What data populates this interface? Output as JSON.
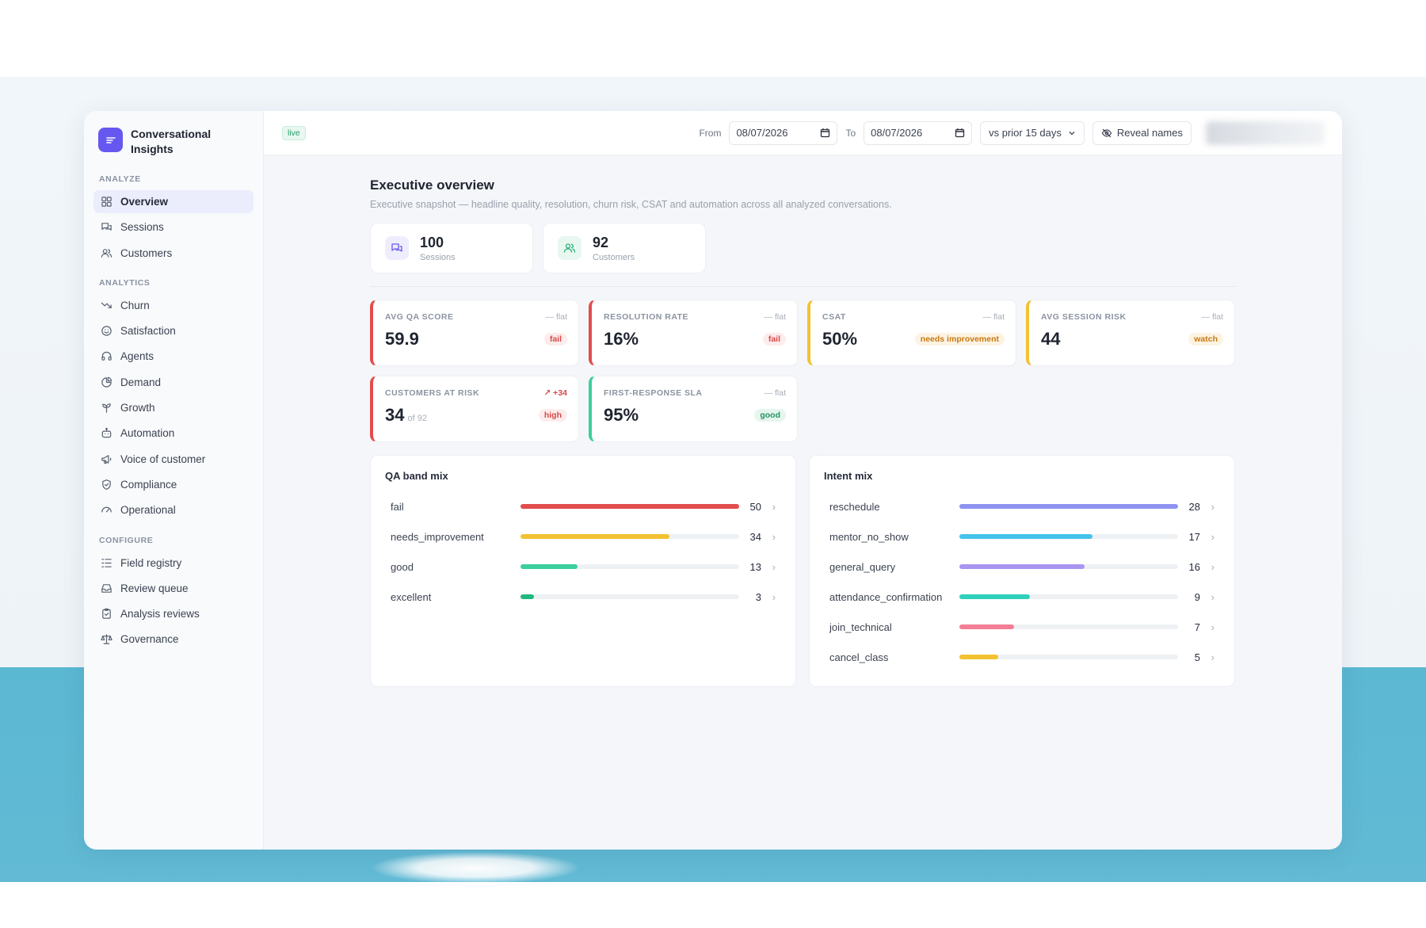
{
  "app": {
    "name": "Conversational Insights"
  },
  "sidebar": {
    "sections": [
      {
        "title": "ANALYZE",
        "items": [
          {
            "label": "Overview",
            "icon": "grid-icon",
            "active": true
          },
          {
            "label": "Sessions",
            "icon": "chat-icon"
          },
          {
            "label": "Customers",
            "icon": "users-icon"
          }
        ]
      },
      {
        "title": "ANALYTICS",
        "items": [
          {
            "label": "Churn",
            "icon": "trend-down-icon"
          },
          {
            "label": "Satisfaction",
            "icon": "smile-icon"
          },
          {
            "label": "Agents",
            "icon": "headset-icon"
          },
          {
            "label": "Demand",
            "icon": "pie-icon"
          },
          {
            "label": "Growth",
            "icon": "sprout-icon"
          },
          {
            "label": "Automation",
            "icon": "bot-icon"
          },
          {
            "label": "Voice of customer",
            "icon": "megaphone-icon"
          },
          {
            "label": "Compliance",
            "icon": "shield-icon"
          },
          {
            "label": "Operational",
            "icon": "gauge-icon"
          }
        ]
      },
      {
        "title": "CONFIGURE",
        "items": [
          {
            "label": "Field registry",
            "icon": "list-icon"
          },
          {
            "label": "Review queue",
            "icon": "inbox-icon"
          },
          {
            "label": "Analysis reviews",
            "icon": "clipboard-icon"
          },
          {
            "label": "Governance",
            "icon": "scale-icon"
          }
        ]
      }
    ]
  },
  "topbar": {
    "live": "live",
    "from_label": "From",
    "from_value": "08/07/2026",
    "to_label": "To",
    "to_value": "08/07/2026",
    "compare": "vs prior 15 days",
    "reveal": "Reveal names"
  },
  "page": {
    "title": "Executive overview",
    "subtitle": "Executive snapshot — headline quality, resolution, churn risk, CSAT and automation across all analyzed conversations."
  },
  "stats": [
    {
      "value": "100",
      "label": "Sessions",
      "color": "#6657f0",
      "bg": "#eeedfd"
    },
    {
      "value": "92",
      "label": "Customers",
      "color": "#2bb27a",
      "bg": "#e8f7f0"
    }
  ],
  "kpis": [
    {
      "label": "AVG QA SCORE",
      "trend": "— flat",
      "value": "59.9",
      "of": "",
      "badge": "fail",
      "tone": "fail",
      "accent": "#e24d4d"
    },
    {
      "label": "RESOLUTION RATE",
      "trend": "— flat",
      "value": "16%",
      "of": "",
      "badge": "fail",
      "tone": "fail",
      "accent": "#e24d4d"
    },
    {
      "label": "CSAT",
      "trend": "— flat",
      "value": "50%",
      "of": "",
      "badge": "needs improvement",
      "tone": "warn",
      "accent": "#f2c230"
    },
    {
      "label": "AVG SESSION RISK",
      "trend": "— flat",
      "value": "44",
      "of": "",
      "badge": "watch",
      "tone": "warn",
      "accent": "#f2c230"
    },
    {
      "label": "CUSTOMERS AT RISK",
      "trend": "↗ +34",
      "trend_up": true,
      "value": "34",
      "of": "of 92",
      "badge": "high",
      "tone": "fail",
      "accent": "#e24d4d"
    },
    {
      "label": "FIRST-RESPONSE SLA",
      "trend": "— flat",
      "value": "95%",
      "of": "",
      "badge": "good",
      "tone": "good",
      "accent": "#3ccf9c"
    }
  ],
  "qa_mix": {
    "title": "QA band mix",
    "max": 50,
    "rows": [
      {
        "label": "fail",
        "count": 50,
        "color": "#e24d4d"
      },
      {
        "label": "needs_improvement",
        "count": 34,
        "color": "#f2c230"
      },
      {
        "label": "good",
        "count": 13,
        "color": "#3ccf9c"
      },
      {
        "label": "excellent",
        "count": 3,
        "color": "#1fb97f"
      }
    ]
  },
  "intent_mix": {
    "title": "Intent mix",
    "max": 28,
    "rows": [
      {
        "label": "reschedule",
        "count": 28,
        "color": "#8f93f0"
      },
      {
        "label": "mentor_no_show",
        "count": 17,
        "color": "#45c3ea"
      },
      {
        "label": "general_query",
        "count": 16,
        "color": "#a995f0"
      },
      {
        "label": "attendance_confirmation",
        "count": 9,
        "color": "#2fd0bc"
      },
      {
        "label": "join_technical",
        "count": 7,
        "color": "#f27f95"
      },
      {
        "label": "cancel_class",
        "count": 5,
        "color": "#f2c230"
      }
    ]
  }
}
